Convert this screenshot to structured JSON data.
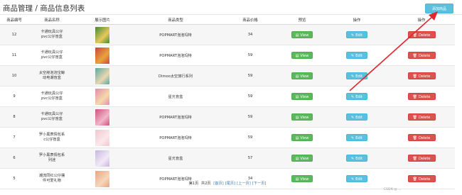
{
  "header": {
    "title": "商品管理 / 商品信息列表",
    "add_button": "添加商品"
  },
  "table": {
    "columns": [
      "商品编号",
      "商品名称",
      "展示图片",
      "商品类型",
      "商品价格",
      "预览",
      "操作",
      "操作"
    ],
    "rows": [
      {
        "id": "12",
        "name_line1": "卡通玩具公仔",
        "name_line2": "pvc公仔盲盒",
        "type": "POPMART泡泡玛特",
        "price": "34",
        "image": "product-thumb-green"
      },
      {
        "id": "11",
        "name_line1": "卡通玩具公仔",
        "name_line2": "pvc公仔盲盒",
        "type": "POPMART泡泡玛特",
        "price": "59",
        "image": "product-thumb-red"
      },
      {
        "id": "10",
        "name_line1": "太空舱泡泡宝鲸",
        "name_line2": "动电潮盲盒",
        "type": "Dimoo太空旅行系列",
        "price": "59",
        "image": "product-thumb-teal"
      },
      {
        "id": "9",
        "name_line1": "卡通玩具公仔",
        "name_line2": "pvc公仔盲盒",
        "type": "星光盲盒",
        "price": "59",
        "image": "product-thumb-pink"
      },
      {
        "id": "8",
        "name_line1": "卡通玩具公仔",
        "name_line2": "pvc公仔盲盒",
        "type": "POPMART泡泡玛特",
        "price": "59",
        "image": "product-thumb-rose"
      },
      {
        "id": "7",
        "name_line1": "罗小黑表情包系",
        "name_line2": "c公仔盲盒",
        "type": "POPMART泡泡玛特",
        "price": "59",
        "image": "product-thumb-blush"
      },
      {
        "id": "6",
        "name_line1": "罗小黑表情包系",
        "name_line2": "列迷",
        "type": "星光盲盒",
        "price": "57",
        "image": "product-thumb-lilac"
      },
      {
        "id": "5",
        "name_line1": "潮流同红公仔摆",
        "name_line2": "件可爱礼物",
        "type": "POPMART泡泡玛特",
        "price": "34",
        "image": "product-thumb-peach"
      }
    ],
    "view_label": "View",
    "edit_label": "Edit",
    "delete_label": "Delete"
  },
  "pagination": {
    "current": "第1页",
    "total": "共2页",
    "first": "[首页]",
    "last": "[尾页]",
    "prev": "[上一页]",
    "next": "[下一页]"
  },
  "watermark": "CSDN @ ..."
}
